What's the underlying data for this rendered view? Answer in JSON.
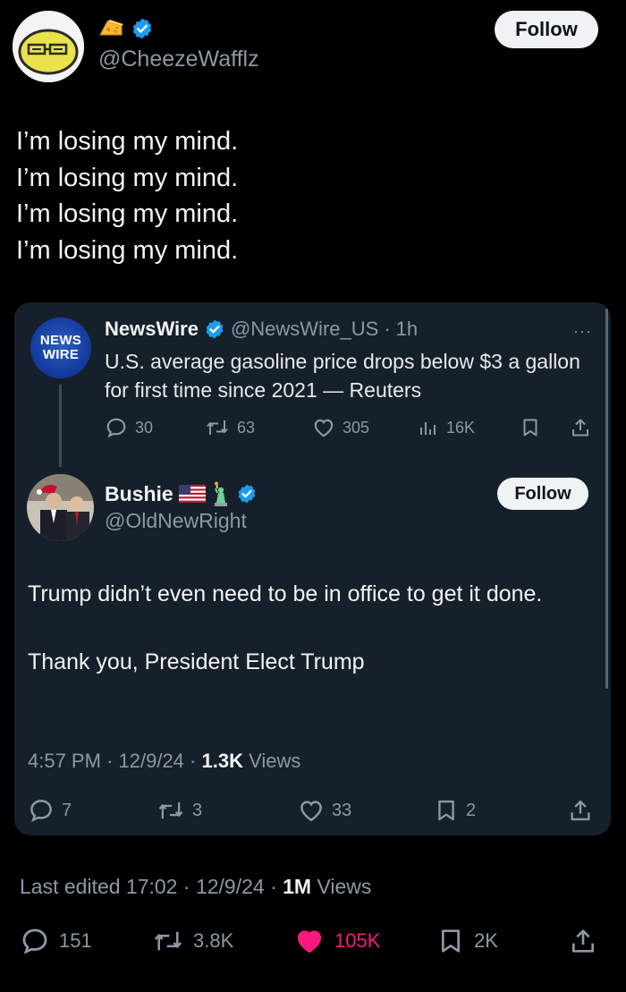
{
  "author": {
    "handle": "@CheezeWafflz",
    "follow_label": "Follow",
    "name_emoji_icon": "cheese-icon",
    "verified_icon": "verified-badge-icon"
  },
  "tweet": {
    "lines": [
      "I’m losing my mind.",
      "I’m losing my mind.",
      "I’m losing my mind.",
      "I’m losing my mind."
    ]
  },
  "quoted_parent": {
    "avatar_line1": "NEWS",
    "avatar_line2": "WIRE",
    "name": "NewsWire",
    "handle": "@NewsWire_US",
    "separator": "·",
    "time": "1h",
    "more": "···",
    "text": "U.S. average gasoline price drops below $3 a gallon for first time since 2021 — Reuters",
    "replies": "30",
    "reposts": "63",
    "likes": "305",
    "views": "16K"
  },
  "quoted_reply": {
    "name": "Bushie",
    "handle": "@OldNewRight",
    "follow_label": "Follow",
    "paragraph1": "Trump didn’t even need to be in office to get it done.",
    "paragraph2": "Thank you, President Elect Trump",
    "time": "4:57 PM",
    "date": "12/9/24",
    "views_count": "1.3K",
    "views_label": "Views",
    "sep": "·",
    "replies": "7",
    "reposts": "3",
    "likes": "33",
    "bookmarks": "2"
  },
  "footer": {
    "edited_label": "Last edited 17:02",
    "date": "12/9/24",
    "sep": "·",
    "views_count": "1M",
    "views_label": "Views",
    "replies": "151",
    "reposts": "3.8K",
    "likes": "105K",
    "bookmarks": "2K"
  },
  "colors": {
    "background": "#000000",
    "card": "#16202a",
    "verified_blue": "#1d9bf0",
    "like_pink": "#f91880",
    "muted": "#8b98a5"
  }
}
